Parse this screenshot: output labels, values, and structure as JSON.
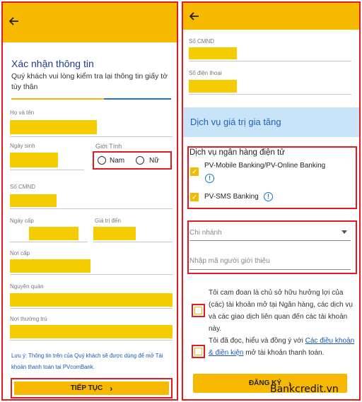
{
  "left": {
    "back_icon": "arrow-left-icon",
    "title": "Xác nhận thông tin",
    "subtitle": "Quý khách vui lòng kiểm tra lại thông tin giấy tờ tùy thân",
    "progress_fraction": 0.58,
    "fields": {
      "full_name": "Họ và tên",
      "dob": "Ngày sinh",
      "gender": "Giới Tính",
      "gender_male": "Nam",
      "gender_female": "Nữ",
      "id_number": "Số CMND",
      "issue_date": "Ngày cấp",
      "valid_until": "Giá trị đến",
      "issue_place": "Nơi cấp",
      "hometown": "Nguyên quán",
      "residence": "Nơi thường trú"
    },
    "note": "Lưu ý: Thông tin trên của Quý khách sẽ được dùng để mở Tài khoản thanh toán tại PVcomBank.",
    "continue_label": "TIẾP TỤC"
  },
  "right": {
    "back_icon": "arrow-left-icon",
    "fields": {
      "id_number": "Số CMND",
      "phone": "Số điện thoại"
    },
    "vas_title": "Dịch vụ giá trị gia tăng",
    "ebank_title": "Dịch vụ ngân hàng điện tử",
    "option1": "PV-Mobile Banking/PV-Online Banking",
    "option2": "PV-SMS Banking",
    "branch_placeholder": "Chi nhánh",
    "referral_placeholder": "Nhập mã người giới thiệu",
    "term1": "Tôi cam đoan là chủ sở hữu hưởng lợi của (các) tài khoản mở tại Ngân hàng, các dịch vụ và các giao dịch liên quan đến các tài khoản này.",
    "term2_prefix": "Tôi đã đọc, hiểu và đồng ý với",
    "term2_link": "Các điều khoản & điền kiện",
    "term2_suffix": "mở tài khoản thanh toán.",
    "register_label": "ĐĂNG KÝ"
  },
  "watermark": "Bankcredit.vn",
  "colors": {
    "accent_yellow": "#f7b800",
    "highlight_red": "#e11b22",
    "title_blue": "#1e3c8c",
    "vas_bg": "#c9e3f8"
  }
}
